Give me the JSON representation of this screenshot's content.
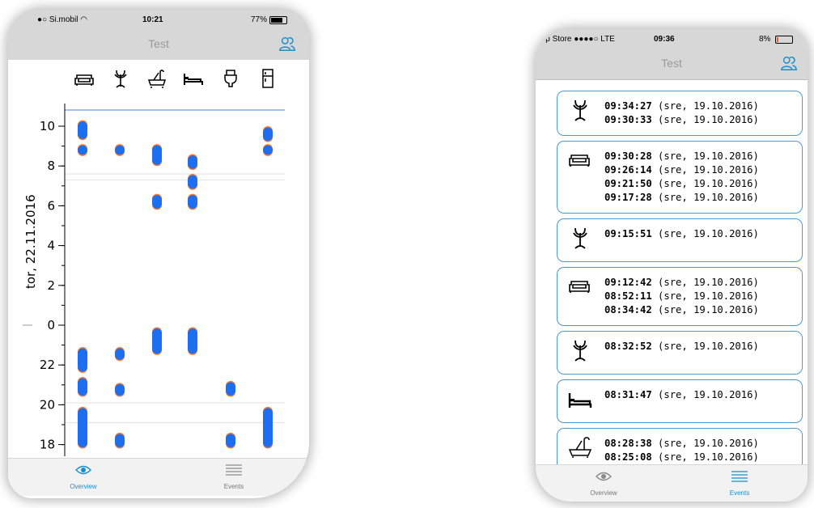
{
  "left_phone": {
    "status": {
      "carrier": "Si.mobil",
      "time": "10:21",
      "battery": "77%"
    },
    "title": "Test",
    "y_axis_label": "tor, 22.11.2016",
    "y_ticks": [
      "10",
      "8",
      "6",
      "4",
      "2",
      "0",
      "22",
      "20",
      "18"
    ],
    "columns": [
      "sofa-icon",
      "coat-rack-icon",
      "bathtub-icon",
      "bed-icon",
      "toilet-icon",
      "fridge-icon"
    ],
    "event_bars": [
      {
        "column": 0,
        "from": 9.3,
        "to": 10.3
      },
      {
        "column": 0,
        "from": 8.5,
        "to": 9.1
      },
      {
        "column": 0,
        "from": 21.6,
        "to": 22.9
      },
      {
        "column": 0,
        "from": 20.4,
        "to": 21.4
      },
      {
        "column": 0,
        "from": 17.8,
        "to": 19.9
      },
      {
        "column": 1,
        "from": 8.5,
        "to": 9.1
      },
      {
        "column": 1,
        "from": 22.2,
        "to": 22.9
      },
      {
        "column": 1,
        "from": 20.4,
        "to": 21.1
      },
      {
        "column": 1,
        "from": 17.8,
        "to": 18.6
      },
      {
        "column": 2,
        "from": 8.0,
        "to": 9.1
      },
      {
        "column": 2,
        "from": 5.8,
        "to": 6.6
      },
      {
        "column": 2,
        "from": 22.5,
        "to": 23.9
      },
      {
        "column": 3,
        "from": 7.8,
        "to": 8.6
      },
      {
        "column": 3,
        "from": 6.8,
        "to": 7.6
      },
      {
        "column": 3,
        "from": 5.8,
        "to": 6.6
      },
      {
        "column": 3,
        "from": 22.5,
        "to": 23.9
      },
      {
        "column": 4,
        "from": 20.4,
        "to": 21.2
      },
      {
        "column": 4,
        "from": 17.8,
        "to": 18.6
      },
      {
        "column": 5,
        "from": 9.2,
        "to": 10.0
      },
      {
        "column": 5,
        "from": 8.5,
        "to": 9.1
      },
      {
        "column": 5,
        "from": 17.8,
        "to": 19.9
      }
    ],
    "tabs": [
      {
        "label": "Overview",
        "active": true
      },
      {
        "label": "Events",
        "active": false
      }
    ]
  },
  "right_phone": {
    "status": {
      "carrier": "App Store",
      "network": "LTE",
      "time": "09:36",
      "battery": "8%"
    },
    "title": "Test",
    "events": [
      {
        "icon": "coat-rack-icon",
        "times": [
          {
            "time": "09:34:27",
            "date": "(sre, 19.10.2016)"
          },
          {
            "time": "09:30:33",
            "date": "(sre, 19.10.2016)"
          }
        ]
      },
      {
        "icon": "sofa-icon",
        "times": [
          {
            "time": "09:30:28",
            "date": "(sre, 19.10.2016)"
          },
          {
            "time": "09:26:14",
            "date": "(sre, 19.10.2016)"
          },
          {
            "time": "09:21:50",
            "date": "(sre, 19.10.2016)"
          },
          {
            "time": "09:17:28",
            "date": "(sre, 19.10.2016)"
          }
        ]
      },
      {
        "icon": "coat-rack-icon",
        "times": [
          {
            "time": "09:15:51",
            "date": "(sre, 19.10.2016)"
          }
        ]
      },
      {
        "icon": "sofa-icon",
        "times": [
          {
            "time": "09:12:42",
            "date": "(sre, 19.10.2016)"
          },
          {
            "time": "08:52:11",
            "date": "(sre, 19.10.2016)"
          },
          {
            "time": "08:34:42",
            "date": "(sre, 19.10.2016)"
          }
        ]
      },
      {
        "icon": "coat-rack-icon",
        "times": [
          {
            "time": "08:32:52",
            "date": "(sre, 19.10.2016)"
          }
        ]
      },
      {
        "icon": "bed-icon",
        "times": [
          {
            "time": "08:31:47",
            "date": "(sre, 19.10.2016)"
          }
        ]
      },
      {
        "icon": "bathtub-icon",
        "times": [
          {
            "time": "08:28:38",
            "date": "(sre, 19.10.2016)"
          },
          {
            "time": "08:25:08",
            "date": "(sre, 19.10.2016)"
          }
        ]
      }
    ],
    "tabs": [
      {
        "label": "Overview",
        "active": false
      },
      {
        "label": "Events",
        "active": true
      }
    ]
  },
  "colors": {
    "accent": "#1a8fc9",
    "event_bar": "#1e6ff0",
    "event_cap": "#ff7a2a",
    "card_border": "#4a9bd1",
    "bar_bg": "#d7d7d7"
  }
}
